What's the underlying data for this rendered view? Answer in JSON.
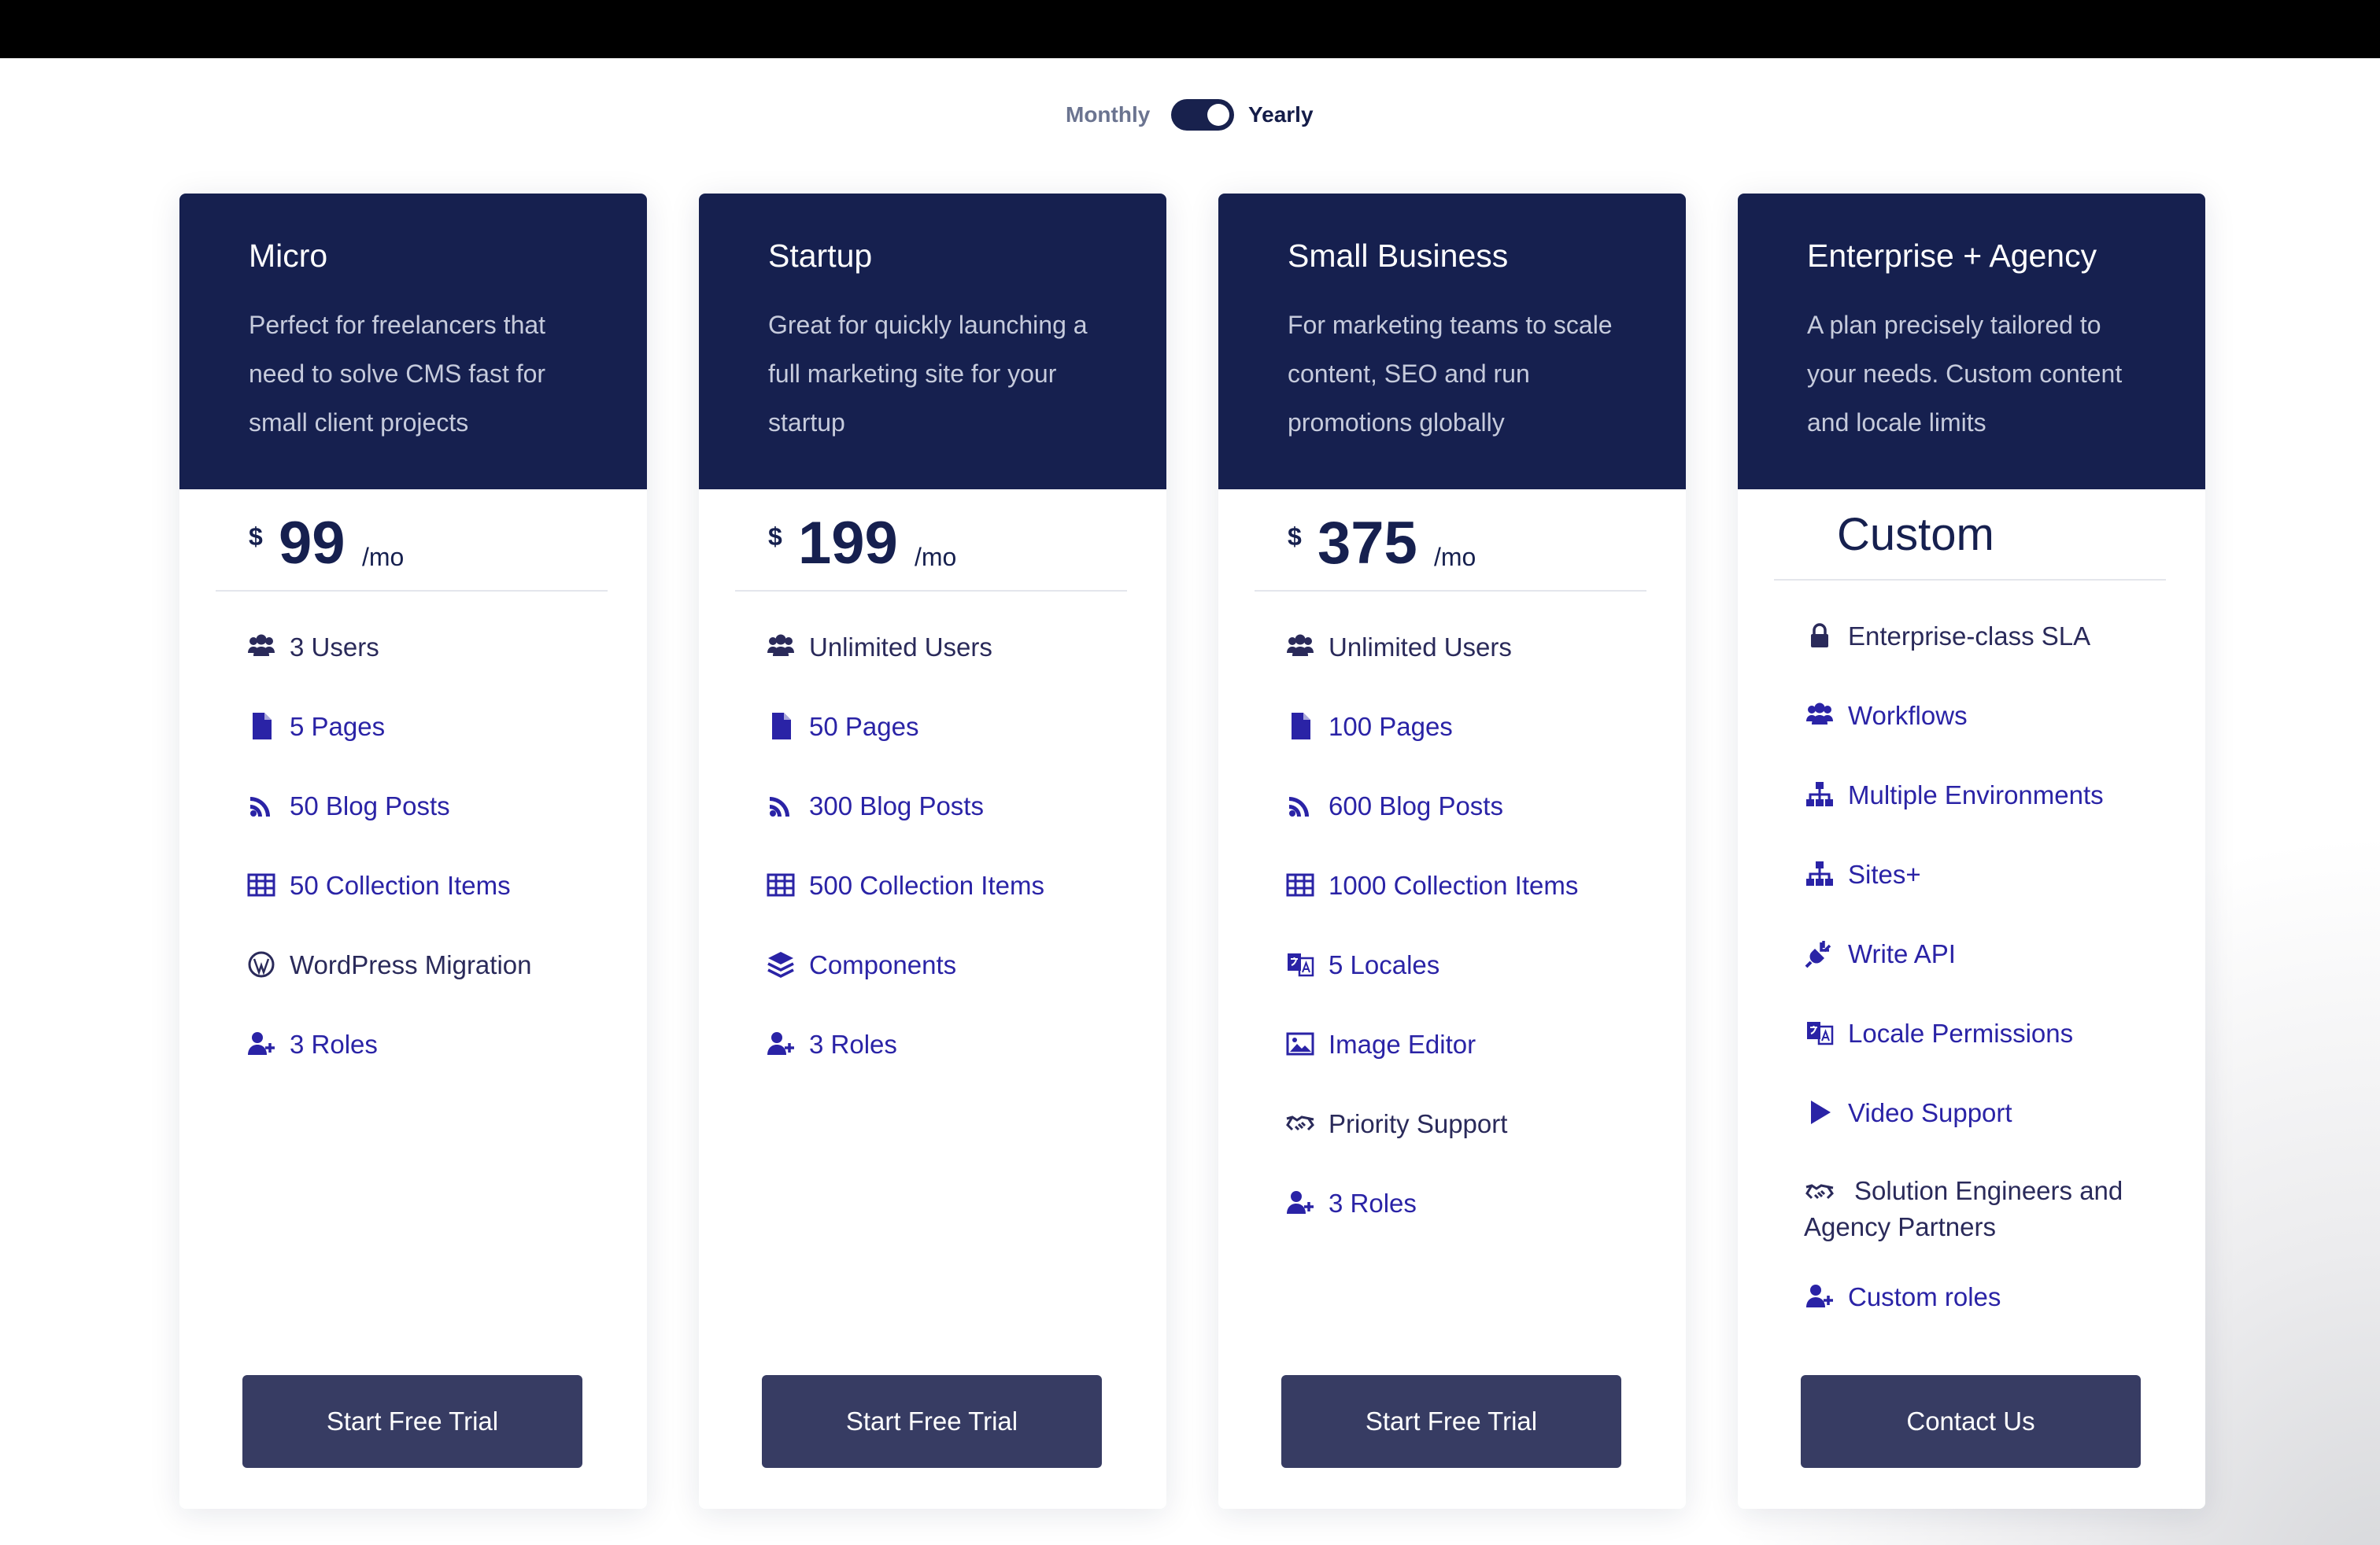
{
  "billing_toggle": {
    "monthly_label": "Monthly",
    "yearly_label": "Yearly",
    "selected": "Yearly"
  },
  "colors": {
    "header_bg": "#16204f",
    "header_text": "#ffffff",
    "header_desc": "#c6cbdc",
    "feature_accent": "#2a23a6",
    "feature_plain": "#2a2a5a",
    "button_bg": "#373c63",
    "toggle_bg": "#18214d"
  },
  "plans": [
    {
      "name": "Micro",
      "description": "Perfect for freelancers that need to solve CMS fast for small client projects",
      "currency": "$",
      "price": "99",
      "period": "/mo",
      "cta": "Start Free Trial",
      "features": [
        {
          "icon": "users-icon",
          "label": "3 Users",
          "accent": false
        },
        {
          "icon": "file-icon",
          "label": "5 Pages",
          "accent": true
        },
        {
          "icon": "rss-icon",
          "label": "50 Blog Posts",
          "accent": true
        },
        {
          "icon": "table-icon",
          "label": "50 Collection Items",
          "accent": true
        },
        {
          "icon": "wordpress-icon",
          "label": "WordPress Migration",
          "accent": false
        },
        {
          "icon": "user-plus-icon",
          "label": "3 Roles",
          "accent": true
        }
      ]
    },
    {
      "name": "Startup",
      "description": "Great for quickly launching a full marketing site for your startup",
      "currency": "$",
      "price": "199",
      "period": "/mo",
      "cta": "Start Free Trial",
      "features": [
        {
          "icon": "users-icon",
          "label": "Unlimited Users",
          "accent": false
        },
        {
          "icon": "file-icon",
          "label": "50 Pages",
          "accent": true
        },
        {
          "icon": "rss-icon",
          "label": "300 Blog Posts",
          "accent": true
        },
        {
          "icon": "table-icon",
          "label": "500 Collection Items",
          "accent": true
        },
        {
          "icon": "layers-icon",
          "label": "Components",
          "accent": true
        },
        {
          "icon": "user-plus-icon",
          "label": "3 Roles",
          "accent": true
        }
      ]
    },
    {
      "name": "Small Business",
      "description": "For marketing teams to scale content, SEO and run promotions globally",
      "currency": "$",
      "price": "375",
      "period": "/mo",
      "cta": "Start Free Trial",
      "features": [
        {
          "icon": "users-icon",
          "label": "Unlimited Users",
          "accent": false
        },
        {
          "icon": "file-icon",
          "label": "100 Pages",
          "accent": true
        },
        {
          "icon": "rss-icon",
          "label": "600 Blog Posts",
          "accent": true
        },
        {
          "icon": "table-icon",
          "label": "1000 Collection Items",
          "accent": true
        },
        {
          "icon": "language-icon",
          "label": "5 Locales",
          "accent": true
        },
        {
          "icon": "image-icon",
          "label": "Image Editor",
          "accent": true
        },
        {
          "icon": "handshake-icon",
          "label": "Priority Support",
          "accent": false
        },
        {
          "icon": "user-plus-icon",
          "label": "3 Roles",
          "accent": true
        }
      ]
    },
    {
      "name": "Enterprise + Agency",
      "description": "A plan precisely tailored to your needs. Custom content and locale limits",
      "custom_price": "Custom",
      "cta": "Contact Us",
      "features": [
        {
          "icon": "lock-icon",
          "label": "Enterprise-class SLA",
          "accent": false
        },
        {
          "icon": "users-icon",
          "label": "Workflows",
          "accent": true
        },
        {
          "icon": "sitemap-icon",
          "label": "Multiple Environments",
          "accent": true
        },
        {
          "icon": "sitemap-icon",
          "label": "Sites+",
          "accent": true
        },
        {
          "icon": "plug-icon",
          "label": "Write API",
          "accent": true
        },
        {
          "icon": "language-icon",
          "label": "Locale Permissions",
          "accent": true
        },
        {
          "icon": "play-icon",
          "label": "Video Support",
          "accent": true
        },
        {
          "icon": "handshake-icon",
          "label": "Solution Engineers and Agency Partners",
          "accent": false
        },
        {
          "icon": "user-plus-icon",
          "label": "Custom roles",
          "accent": true
        }
      ]
    }
  ]
}
